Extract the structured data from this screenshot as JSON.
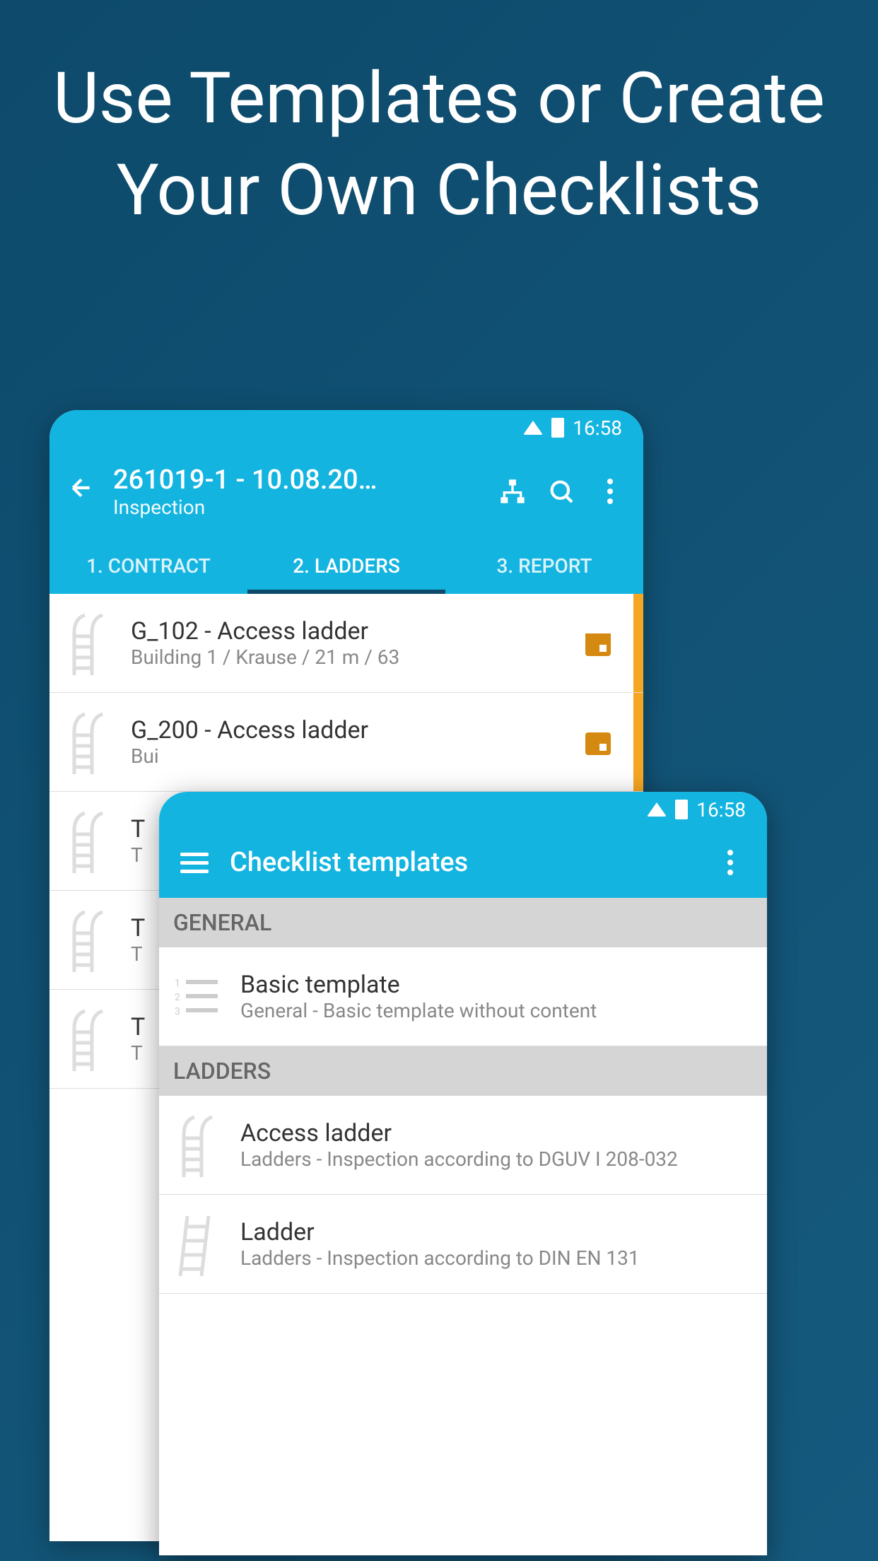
{
  "headline": "Use Templates or Create Your Own Checklists",
  "status": {
    "time": "16:58"
  },
  "inspection": {
    "title": "261019-1 - 10.08.20…",
    "subtitle": "Inspection",
    "tabs": [
      "1. CONTRACT",
      "2. LADDERS",
      "3. REPORT"
    ],
    "items": [
      {
        "title": "G_102 - Access ladder",
        "subtitle": "Building 1  / Krause / 21 m / 63"
      },
      {
        "title": "G_200 - Access ladder",
        "subtitle": "Bui"
      },
      {
        "title": "T",
        "subtitle": "T"
      },
      {
        "title": "T",
        "subtitle": "T"
      },
      {
        "title": "T",
        "subtitle": "T"
      }
    ]
  },
  "templates": {
    "title": "Checklist templates",
    "sections": [
      {
        "name": "GENERAL",
        "items": [
          {
            "title": "Basic template",
            "subtitle": "General - Basic template without content",
            "icon": "list"
          }
        ]
      },
      {
        "name": "LADDERS",
        "items": [
          {
            "title": "Access ladder",
            "subtitle": "Ladders - Inspection according to DGUV I 208-032",
            "icon": "access-ladder"
          },
          {
            "title": "Ladder",
            "subtitle": "Ladders - Inspection according to DIN EN 131",
            "icon": "ladder"
          }
        ]
      }
    ]
  }
}
